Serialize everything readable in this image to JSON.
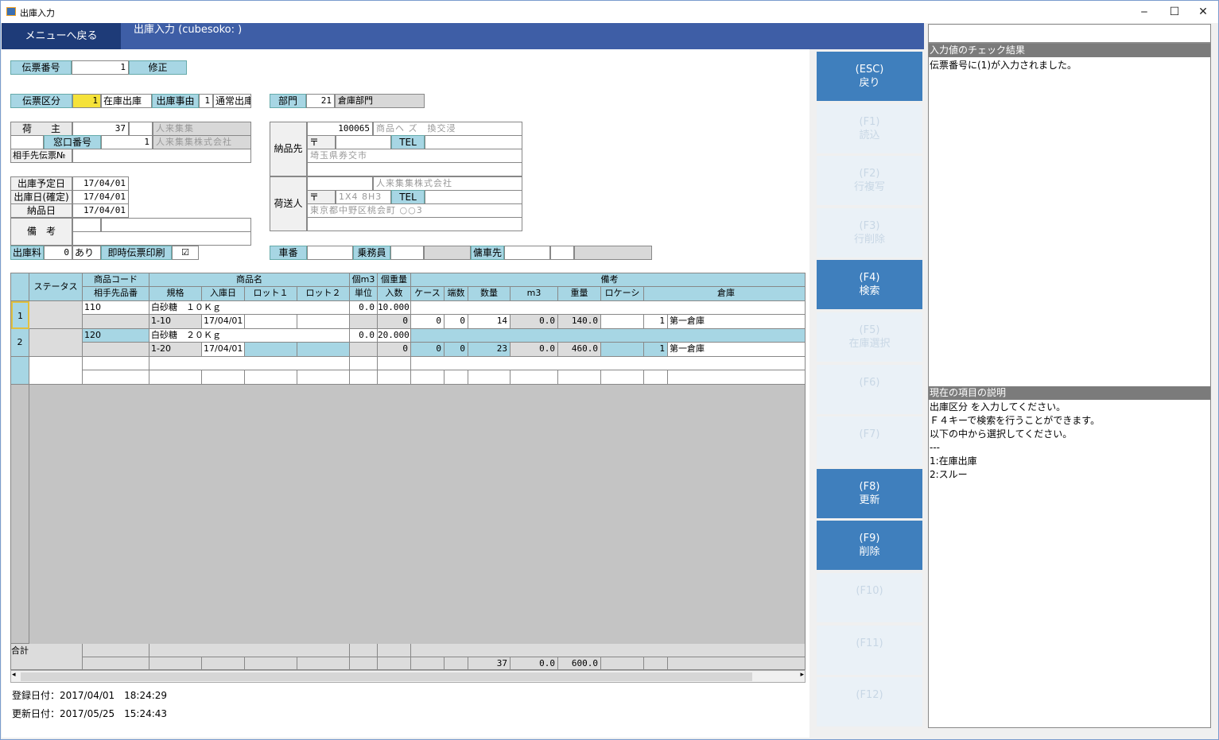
{
  "window": {
    "title": "出庫入力",
    "minimize": "‒",
    "maximize": "☐",
    "close": "✕"
  },
  "header": {
    "menu_button": "メニューへ戻る",
    "title": "出庫入力 (cubesoko:            )"
  },
  "form": {
    "slip_no_label": "伝票番号",
    "slip_no": "1",
    "slip_mode": "修正",
    "slip_type_label": "伝票区分",
    "slip_type": "1",
    "slip_type_name": "在庫出庫",
    "reason_label": "出庫事由",
    "reason": "1",
    "reason_name": "通常出庫",
    "dept_label": "部門",
    "dept": "21",
    "dept_name": "倉庫部門",
    "owner_label": "荷　　主",
    "owner": "37",
    "owner_name": "人来集集",
    "window_no_label": "窓口番号",
    "window_no": "1",
    "window_name": "人来集集株式会社",
    "partner_slip_label": "相手先伝票№",
    "delivery_label": "納品先",
    "delivery_code": "100065",
    "delivery_name": "商品ヘ ズ　換交浸",
    "postal_mark": "〒",
    "tel_label": "TEL",
    "delivery_addr": "埼玉県券交市",
    "sender_label": "荷送人",
    "sender_name": "人来集集株式会社",
    "sender_postal": "1X4 8H3",
    "sender_addr": "東京都中野区桃会町 ○○3",
    "planned_date_label": "出庫予定日",
    "planned_date": "17/04/01",
    "ship_date_label": "出庫日(確定)",
    "ship_date": "17/04/01",
    "deliver_date_label": "納品日",
    "deliver_date": "17/04/01",
    "memo_label": "備　考",
    "fee_label": "出庫料",
    "fee": "0",
    "fee_flag": "あり",
    "instant_print_label": "即時伝票印刷",
    "instant_print_check": "☑",
    "car_label": "車番",
    "crew_label": "乗務員",
    "charter_label": "傭車先"
  },
  "grid": {
    "headers_row1": [
      "ステータス",
      "商品コード",
      "商品名",
      "個m3",
      "個重量",
      "備考"
    ],
    "headers_row2": [
      "相手先品番",
      "規格",
      "入庫日",
      "ロット１",
      "ロット２",
      "単位",
      "入数",
      "ケース",
      "端数",
      "数量",
      "m3",
      "重量",
      "ロケーシ",
      "倉庫"
    ],
    "rows": [
      {
        "no": "1",
        "code": "110",
        "name": "白砂糖　１０Ｋｇ",
        "m3u": "0.0",
        "wt": "10.000",
        "partner": "1-10",
        "in_date": "17/04/01",
        "qty_in": "0",
        "cases": "0",
        "frac": "0",
        "qty": "14",
        "m3": "0.0",
        "weight": "140.0",
        "loc": "1",
        "wh": "第一倉庫"
      },
      {
        "no": "2",
        "code": "120",
        "name": "白砂糖　２０Ｋｇ",
        "m3u": "0.0",
        "wt": "20.000",
        "partner": "1-20",
        "in_date": "17/04/01",
        "qty_in": "0",
        "cases": "0",
        "frac": "0",
        "qty": "23",
        "m3": "0.0",
        "weight": "460.0",
        "loc": "1",
        "wh": "第一倉庫"
      }
    ],
    "total_label": "合計",
    "total_qty": "37",
    "total_m3": "0.0",
    "total_weight": "600.0"
  },
  "footer": {
    "created": "登録日付：2017/04/01　18:24:29",
    "updated": "更新日付：2017/05/25　15:24:43"
  },
  "fkeys": [
    {
      "key": "(ESC)",
      "label": "戻り",
      "enabled": true
    },
    {
      "key": "(F1)",
      "label": "読込",
      "enabled": false
    },
    {
      "key": "(F2)",
      "label": "行複写",
      "enabled": false
    },
    {
      "key": "(F3)",
      "label": "行削除",
      "enabled": false
    },
    {
      "key": "(F4)",
      "label": "検索",
      "enabled": true
    },
    {
      "key": "(F5)",
      "label": "在庫選択",
      "enabled": false
    },
    {
      "key": "(F6)",
      "label": "",
      "enabled": false
    },
    {
      "key": "(F7)",
      "label": "",
      "enabled": false
    },
    {
      "key": "(F8)",
      "label": "更新",
      "enabled": true
    },
    {
      "key": "(F9)",
      "label": "削除",
      "enabled": true
    },
    {
      "key": "(F10)",
      "label": "",
      "enabled": false
    },
    {
      "key": "(F11)",
      "label": "",
      "enabled": false
    },
    {
      "key": "(F12)",
      "label": "",
      "enabled": false
    }
  ],
  "right": {
    "check_title": "入力値のチェック結果",
    "check_text": "伝票番号に(1)が入力されました。",
    "help_title": "現在の項目の説明",
    "help_text": "出庫区分 を入力してください。\nＦ４キーで検索を行うことができます。\n以下の中から選択してください。\n---\n1:在庫出庫\n2:スルー"
  },
  "colors": {
    "header": "#3e5ea6",
    "label_bg": "#a7d6e4",
    "fkey_on": "#3f7fbd",
    "highlight": "#f5e23a"
  }
}
